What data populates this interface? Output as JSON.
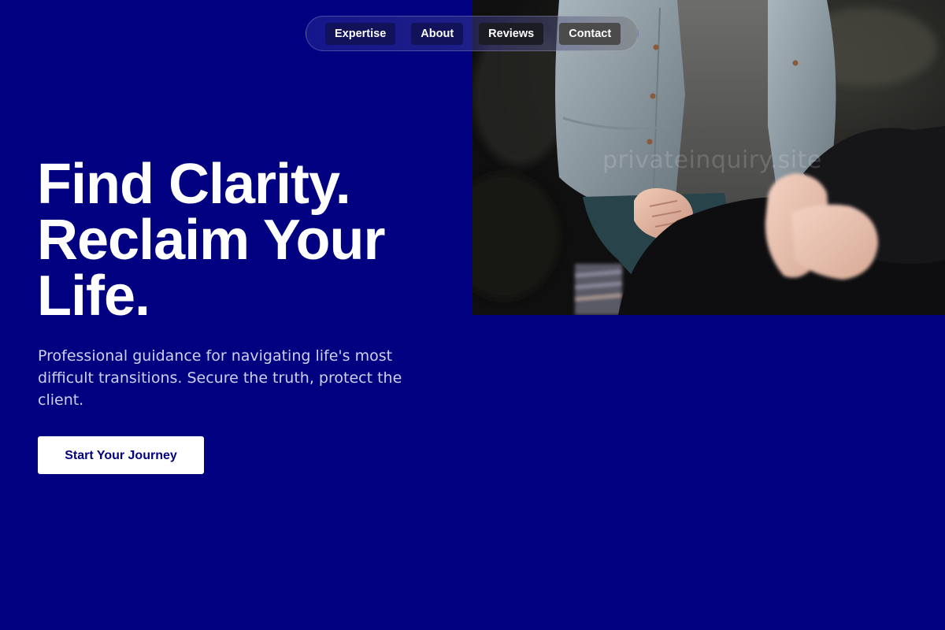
{
  "nav": {
    "items": [
      {
        "label": "Expertise"
      },
      {
        "label": "About"
      },
      {
        "label": "Reviews"
      },
      {
        "label": "Contact"
      }
    ]
  },
  "hero": {
    "title_lines": [
      "Find Clarity.",
      "Reclaim Your",
      "Life."
    ],
    "subtitle": "Professional guidance for navigating life's most difficult transitions. Secure the truth, protect the client.",
    "cta_label": "Start Your Journey",
    "image": {
      "subject": "two-people-conversation-photo",
      "watermark": "privateinquiry.site"
    }
  },
  "colors": {
    "background": "#000080",
    "text_primary": "#ffffff",
    "text_secondary": "#cfd0ee",
    "cta_background": "#ffffff",
    "cta_text": "#000080"
  }
}
